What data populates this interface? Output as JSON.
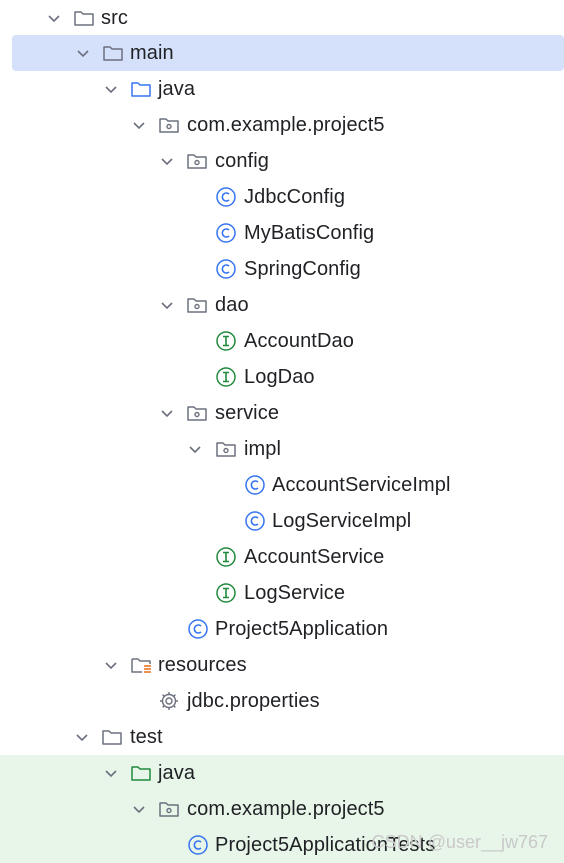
{
  "tree": {
    "nodes": [
      {
        "label": "src",
        "icon": "folder-icon",
        "expanded": true
      },
      {
        "label": "main",
        "icon": "folder-icon",
        "expanded": true,
        "selected": true
      },
      {
        "label": "java",
        "icon": "source-folder-icon",
        "expanded": true
      },
      {
        "label": "com.example.project5",
        "icon": "package-icon",
        "expanded": true
      },
      {
        "label": "config",
        "icon": "package-icon",
        "expanded": true
      },
      {
        "label": "JdbcConfig",
        "icon": "class-icon"
      },
      {
        "label": "MyBatisConfig",
        "icon": "class-icon"
      },
      {
        "label": "SpringConfig",
        "icon": "class-icon"
      },
      {
        "label": "dao",
        "icon": "package-icon",
        "expanded": true
      },
      {
        "label": "AccountDao",
        "icon": "interface-icon"
      },
      {
        "label": "LogDao",
        "icon": "interface-icon"
      },
      {
        "label": "service",
        "icon": "package-icon",
        "expanded": true
      },
      {
        "label": "impl",
        "icon": "package-icon",
        "expanded": true
      },
      {
        "label": "AccountServiceImpl",
        "icon": "class-icon"
      },
      {
        "label": "LogServiceImpl",
        "icon": "class-icon"
      },
      {
        "label": "AccountService",
        "icon": "interface-icon"
      },
      {
        "label": "LogService",
        "icon": "interface-icon"
      },
      {
        "label": "Project5Application",
        "icon": "class-icon"
      },
      {
        "label": "resources",
        "icon": "resources-folder-icon",
        "expanded": true
      },
      {
        "label": "jdbc.properties",
        "icon": "gear-icon"
      },
      {
        "label": "test",
        "icon": "folder-icon",
        "expanded": true
      },
      {
        "label": "java",
        "icon": "test-folder-icon",
        "expanded": true,
        "test": true
      },
      {
        "label": "com.example.project5",
        "icon": "package-icon",
        "expanded": true,
        "test": true
      },
      {
        "label": "Project5ApplicationTests",
        "icon": "class-icon",
        "test": true
      }
    ]
  },
  "watermark": "CSDN @user__jw767",
  "colors": {
    "selection": "#d5e1fb",
    "test_bg": "#e8f5e9",
    "class_blue": "#3574f0",
    "interface_green": "#208a3c",
    "folder_stroke": "#6c707e",
    "source_folder_blue": "#3574f0",
    "test_folder_green": "#208a3c",
    "resources_orange": "#e66d17"
  }
}
